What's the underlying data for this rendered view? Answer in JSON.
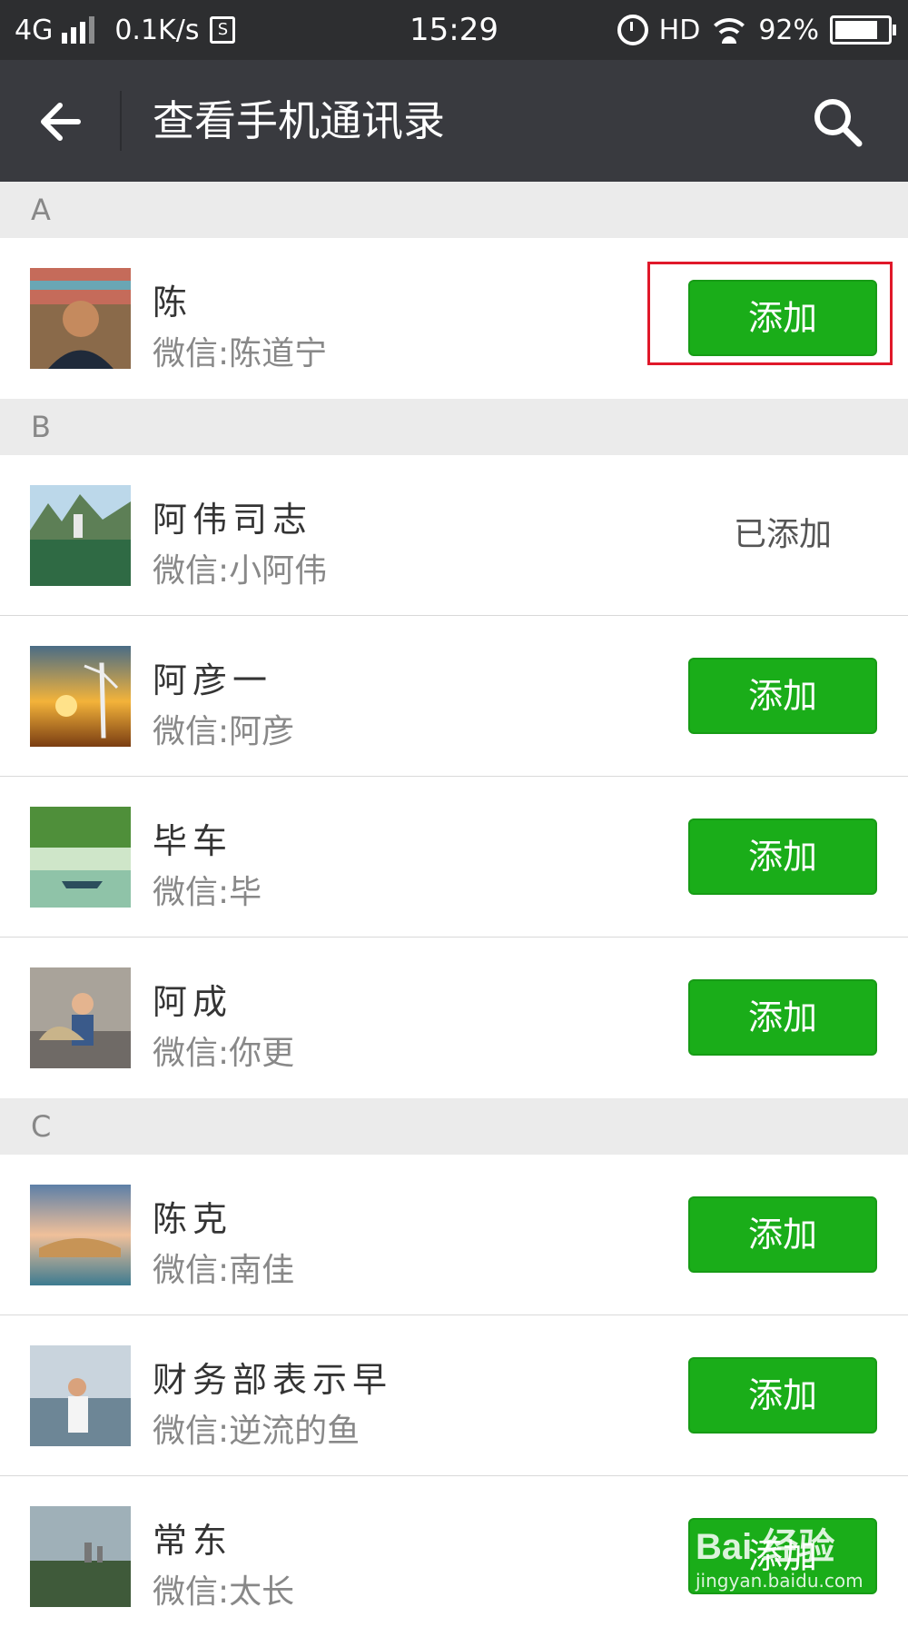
{
  "status_bar": {
    "network": "4G",
    "speed": "0.1K/s",
    "box_glyph": "S",
    "time": "15:29",
    "hd": "HD",
    "battery": "92%",
    "battery_level": 0.92
  },
  "header": {
    "title": "查看手机通讯录"
  },
  "contacts": {
    "sections": [
      {
        "letter": "A"
      },
      {
        "letter": "B"
      },
      {
        "letter": "C"
      }
    ],
    "rows": [
      {
        "name": "陈",
        "wechat": "微信:陈道宁",
        "action": "添加"
      },
      {
        "name": "阿伟司志",
        "wechat": "微信:小阿伟",
        "status": "已添加"
      },
      {
        "name": "阿彦一",
        "wechat": "微信:阿彦",
        "action": "添加"
      },
      {
        "name": "毕车",
        "wechat": "微信:毕",
        "action": "添加"
      },
      {
        "name": "阿成",
        "wechat": "微信:你更",
        "action": "添加"
      },
      {
        "name": "陈克",
        "wechat": "微信:南佳",
        "action": "添加"
      },
      {
        "name": "财务部表示早",
        "wechat": "微信:逆流的鱼",
        "action": "添加"
      },
      {
        "name": "常东",
        "wechat": "微信:太长",
        "action": "添加"
      }
    ]
  },
  "watermark": {
    "logo": "Bai 经验",
    "url": "jingyan.baidu.com"
  },
  "colors": {
    "status_bg": "#2d2e30",
    "header_bg": "#393a3f",
    "add_green": "#1aad19",
    "highlight_red": "#e0182a",
    "section_bg": "#ebebeb"
  }
}
